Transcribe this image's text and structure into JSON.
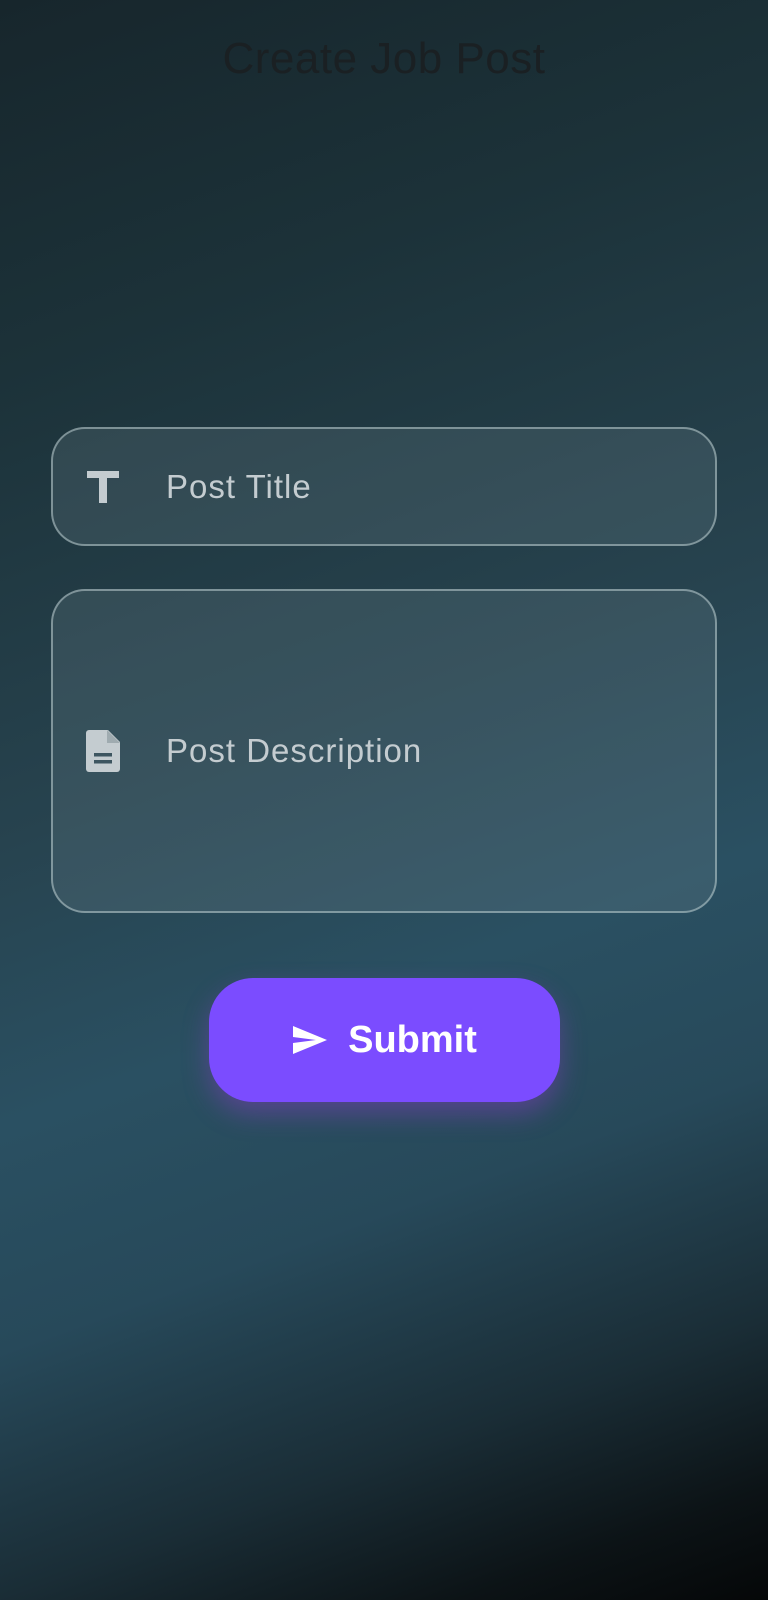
{
  "header": {
    "title": "Create Job Post"
  },
  "form": {
    "title_field": {
      "placeholder": "Post Title",
      "icon": "title-icon"
    },
    "description_field": {
      "placeholder": "Post Description",
      "icon": "description-icon"
    },
    "submit": {
      "label": "Submit",
      "icon": "send-icon"
    }
  },
  "colors": {
    "accent": "#7b4cff",
    "title_text": "#1a2023",
    "field_text": "#c4ccd0"
  }
}
